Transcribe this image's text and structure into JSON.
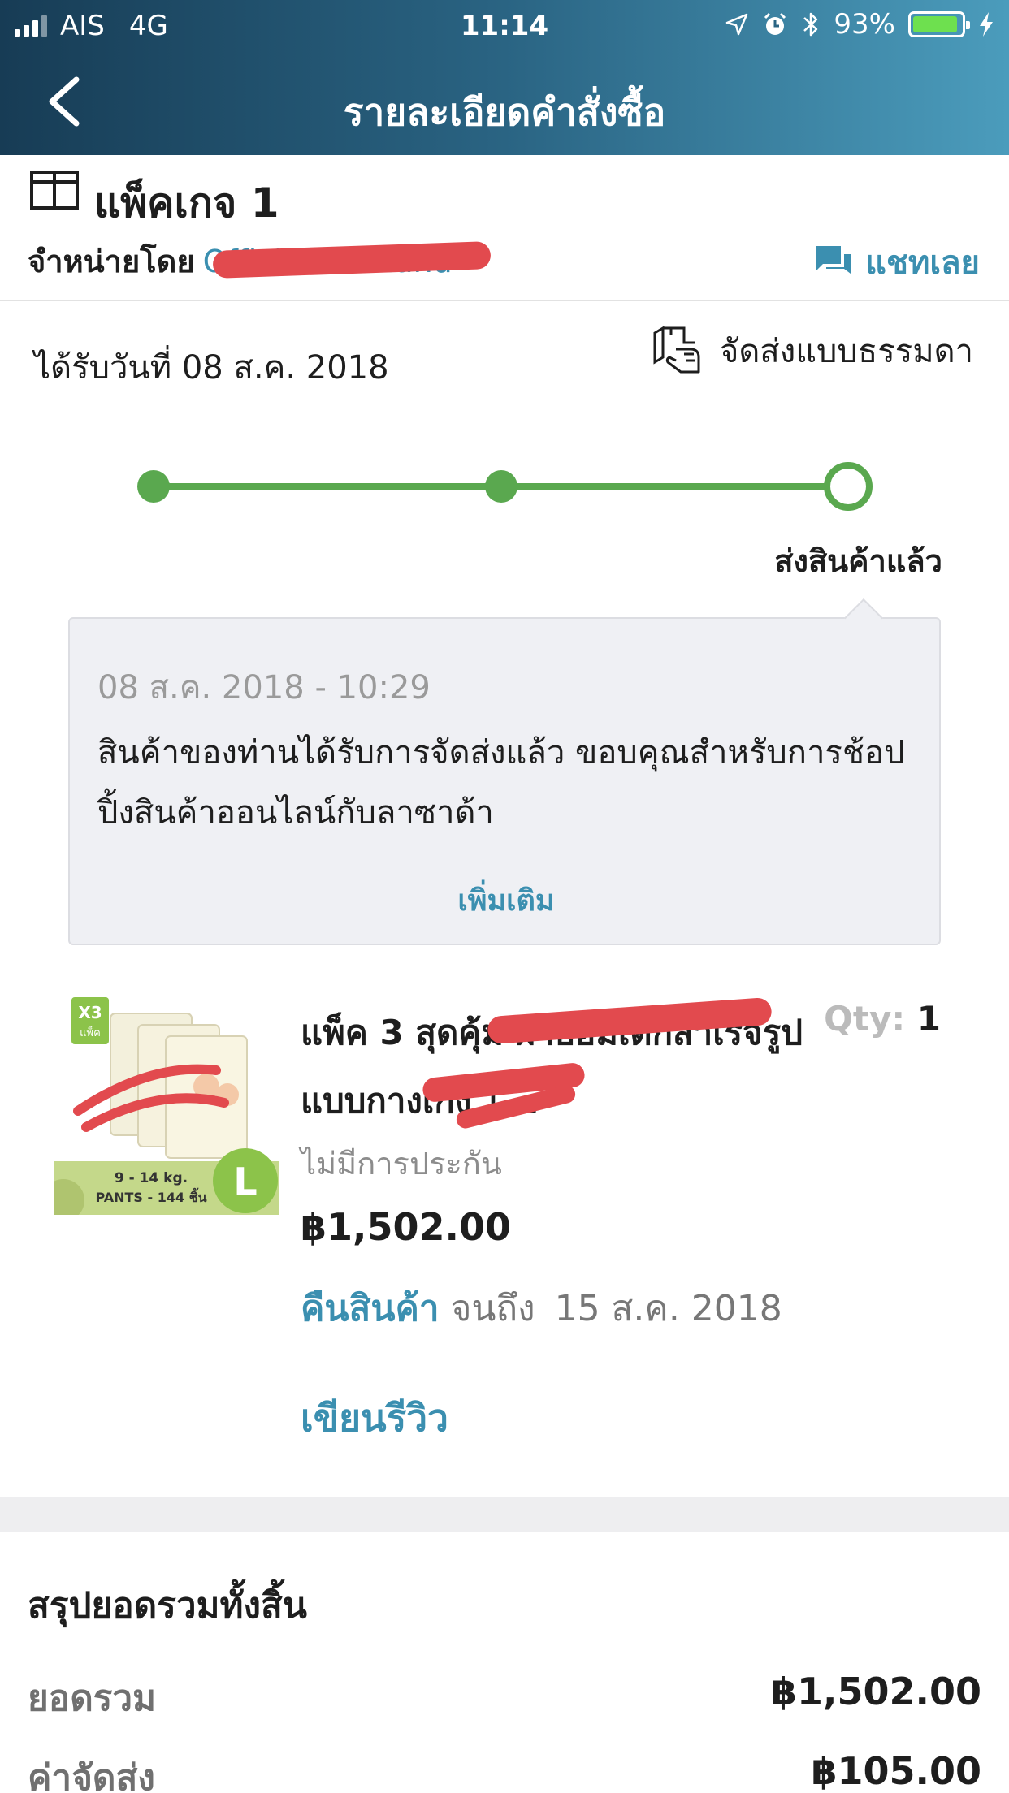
{
  "status_bar": {
    "carrier": "AIS",
    "network": "4G",
    "time": "11:14",
    "battery": "93%",
    "battery_level": 0.93
  },
  "nav": {
    "title": "รายละเอียดคำสั่งซื้อ",
    "back_icon": "chevron-left-icon"
  },
  "package": {
    "title": "แพ็คเกจ 1",
    "sold_by_label": "จำหน่ายโดย",
    "seller_name": "Official Thailand",
    "chat_label": "แชทเลย"
  },
  "delivery": {
    "received_text": "ได้รับวันที่ 08 ส.ค. 2018",
    "shipping_mode": "จัดส่งแบบธรรมดา",
    "current_status": "ส่งสินค้าแล้ว",
    "progress_steps": 3,
    "progress_current_step": 3,
    "status_color": "#5aa84f"
  },
  "tracking": {
    "timestamp": "08 ส.ค. 2018 - 10:29",
    "message": "สินค้าของท่านได้รับการจัดส่งแล้ว ขอบคุณสำหรับการช้อปปิ้งสินค้าออนไลน์กับลาซาด้า",
    "more_label": "เพิ่มเติม"
  },
  "product": {
    "name": "แพ็ค 3 สุดคุ้ม ผ้าอ้อมเด็กสำเร็จรูปแบบกางเกง ไ...",
    "qty_label": "Qty:",
    "qty_value": "1",
    "warranty": "ไม่มีการประกัน",
    "price": "฿1,502.00",
    "return_link": "คืนสินค้า",
    "return_until": "จนถึง",
    "return_date": "15 ส.ค. 2018",
    "review_label": "เขียนรีวิว",
    "image": {
      "badge": "X3",
      "badge_sub": "แพ็ค",
      "weight": "9 - 14 kg.",
      "pants": "PANTS - 144 ชิ้น",
      "size": "L"
    }
  },
  "summary": {
    "title": "สรุปยอดรวมทั้งสิ้น",
    "rows": [
      {
        "label": "ยอดรวม",
        "value": "฿1,502.00"
      },
      {
        "label": "ค่าจัดส่ง",
        "value": "฿105.00"
      }
    ]
  },
  "colors": {
    "accent": "#3b8fb0",
    "progress": "#5aa84f",
    "header_start": "#173c55",
    "header_end": "#4b9cbc"
  }
}
